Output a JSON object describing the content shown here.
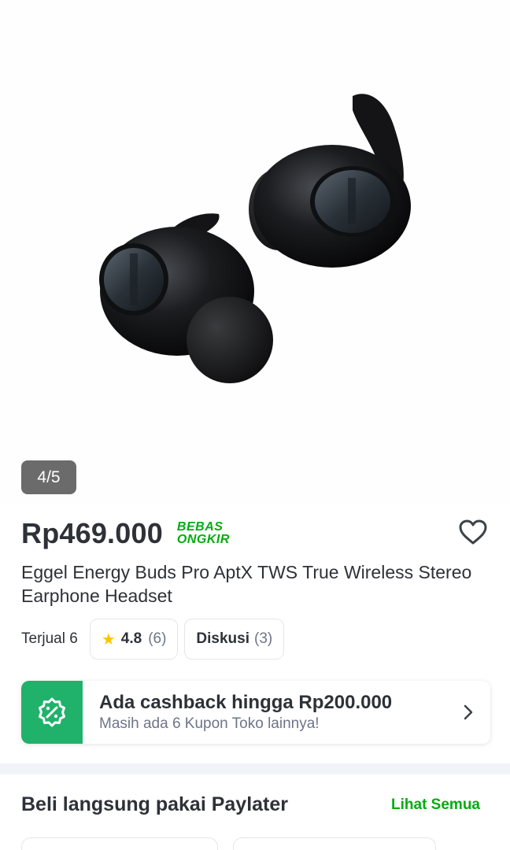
{
  "gallery": {
    "counter": "4/5",
    "image_alt": "black wireless earbuds"
  },
  "product": {
    "price": "Rp469.000",
    "free_shipping_line1": "BEBAS",
    "free_shipping_line2": "ONGKIR",
    "title": "Eggel Energy Buds Pro AptX TWS True Wireless Stereo Earphone Headset",
    "sold": "Terjual 6",
    "rating": "4.8",
    "rating_count": "(6)",
    "discussion_label": "Diskusi",
    "discussion_count": "(3)"
  },
  "cashback": {
    "title": "Ada cashback hingga Rp200.000",
    "subtitle": "Masih ada 6 Kupon Toko lainnya!"
  },
  "paylater": {
    "title": "Beli langsung pakai Paylater",
    "see_all": "Lihat Semua"
  },
  "colors": {
    "accent_green": "#03ac0e",
    "badge_green": "#20b26a",
    "star": "#ffc400",
    "text": "#2e3137",
    "muted": "#6d7588"
  },
  "icons": [
    "heart-icon",
    "star-icon",
    "percent-badge-icon",
    "chevron-right-icon"
  ]
}
